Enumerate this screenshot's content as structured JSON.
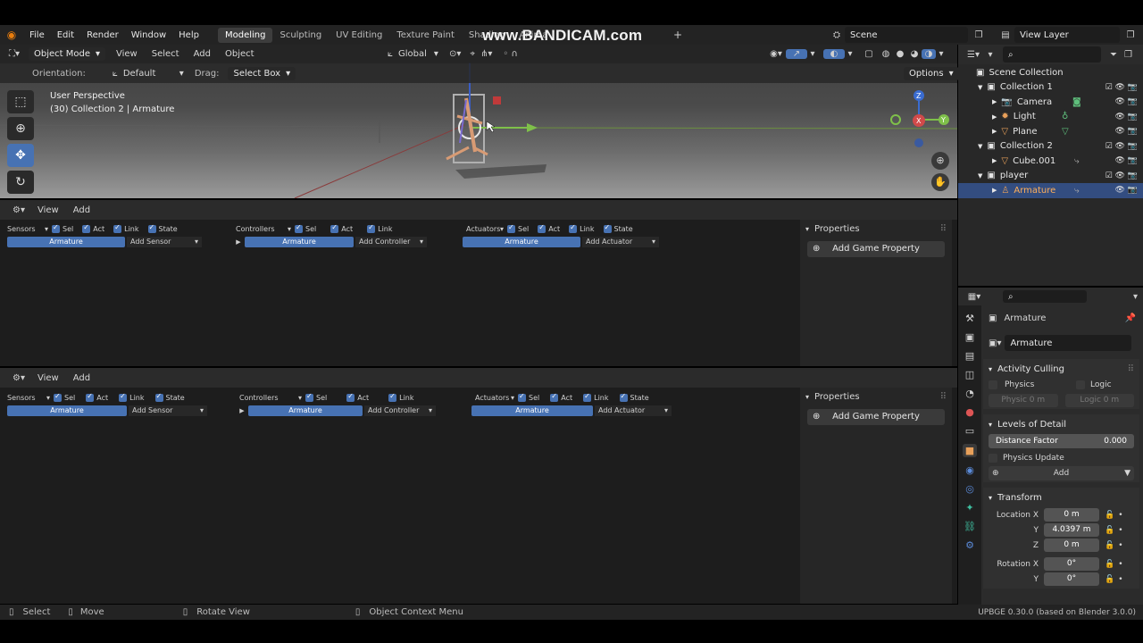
{
  "watermark": "www.BANDICAM.com",
  "topbar": {
    "menus": [
      "File",
      "Edit",
      "Render",
      "Window",
      "Help"
    ],
    "workspaces": [
      "Modeling",
      "Sculpting",
      "UV Editing",
      "Texture Paint",
      "Shading",
      "Anima"
    ],
    "active_workspace": "Modeling",
    "scene_label": "Scene",
    "view_layer_label": "View Layer"
  },
  "viewport": {
    "mode": "Object Mode",
    "menus": [
      "View",
      "Select",
      "Add",
      "Object"
    ],
    "transform_orientation": "Global",
    "orientation_label": "Orientation:",
    "orientation_value": "Default",
    "drag_label": "Drag:",
    "drag_value": "Select Box",
    "options_label": "Options",
    "overlay_title": "User Perspective",
    "overlay_subtitle": "(30) Collection 2 | Armature",
    "gizmo_axes": [
      "Z",
      "X",
      "Y"
    ]
  },
  "logic_editors": [
    {
      "menus": [
        "View",
        "Add"
      ],
      "sensors_label": "Sensors",
      "controllers_label": "Controllers",
      "actuators_label": "Actuators",
      "flags": {
        "sel": "Sel",
        "act": "Act",
        "link": "Link",
        "state": "State"
      },
      "object_name": "Armature",
      "add_sensor": "Add Sensor",
      "add_controller": "Add Controller",
      "add_actuator": "Add Actuator",
      "properties_title": "Properties",
      "add_game_property": "Add Game Property"
    },
    {
      "menus": [
        "View",
        "Add"
      ],
      "sensors_label": "Sensors",
      "controllers_label": "Controllers",
      "actuators_label": "Actuators",
      "flags": {
        "sel": "Sel",
        "act": "Act",
        "link": "Link",
        "state": "State"
      },
      "object_name": "Armature",
      "add_sensor": "Add Sensor",
      "add_controller": "Add Controller",
      "add_actuator": "Add Actuator",
      "properties_title": "Properties",
      "add_game_property": "Add Game Property"
    }
  ],
  "outliner": {
    "rows": [
      {
        "label": "Scene Collection",
        "level": 0
      },
      {
        "label": "Collection 1",
        "level": 1
      },
      {
        "label": "Camera",
        "level": 2
      },
      {
        "label": "Light",
        "level": 2
      },
      {
        "label": "Plane",
        "level": 2
      },
      {
        "label": "Collection 2",
        "level": 1
      },
      {
        "label": "Cube.001",
        "level": 2
      },
      {
        "label": "player",
        "level": 1
      },
      {
        "label": "Armature",
        "level": 2
      }
    ]
  },
  "properties": {
    "object_name": "Armature",
    "data_name": "Armature",
    "activity_culling": "Activity Culling",
    "physics": "Physics",
    "logic": "Logic",
    "physics_dist": "Physic  0 m",
    "logic_dist": "Logic   0 m",
    "lod": "Levels of Detail",
    "distance_factor_label": "Distance Factor",
    "distance_factor_value": "0.000",
    "physics_update": "Physics Update",
    "add": "Add",
    "transform": "Transform",
    "location_x_label": "Location X",
    "location_x": "0 m",
    "y_label": "Y",
    "location_y": "4.0397 m",
    "z_label": "Z",
    "location_z": "0 m",
    "rotation_x_label": "Rotation X",
    "rotation_x": "0°",
    "rotation_y": "0°"
  },
  "statusbar": {
    "select": "Select",
    "move": "Move",
    "rotate": "Rotate View",
    "context": "Object Context Menu",
    "version": "UPBGE 0.30.0 (based on Blender 3.0.0)"
  },
  "colors": {
    "accent": "#4772b3",
    "selected_row": "#334d80"
  }
}
